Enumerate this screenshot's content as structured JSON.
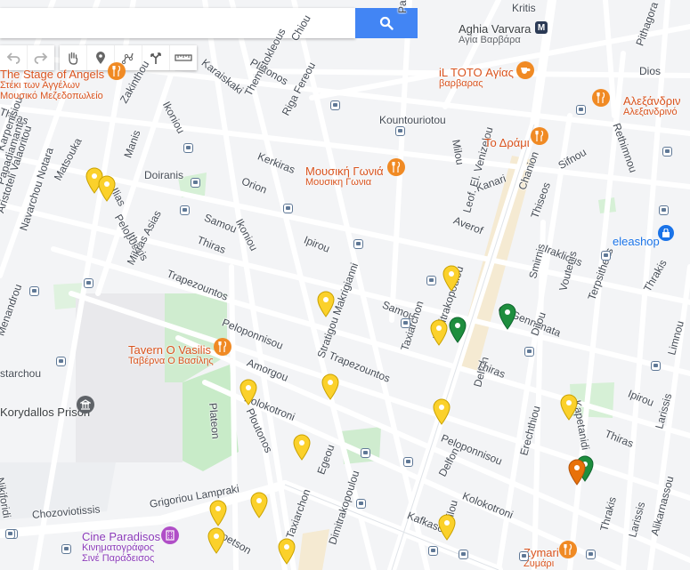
{
  "search": {
    "placeholder": "",
    "button_icon": "search-icon"
  },
  "toolbar": {
    "group1": [
      {
        "icon": "undo-icon"
      },
      {
        "icon": "redo-icon"
      }
    ],
    "group2": [
      {
        "icon": "hand-pan-icon"
      },
      {
        "icon": "add-marker-icon"
      },
      {
        "icon": "draw-line-icon"
      },
      {
        "icon": "add-directions-icon"
      },
      {
        "icon": "measure-ruler-icon"
      }
    ]
  },
  "colors": {
    "accent": "#4285f4",
    "pin_yellow": "#fbd12b",
    "pin_green": "#1e8e3e",
    "pin_orange": "#e8710a",
    "poi_orange": "#f08a24",
    "metro_navy": "#2b3a55"
  },
  "streets": [
    {
      "text": "Kritis",
      "rot": 0
    },
    {
      "text": "Karaiskaki",
      "rot": 38
    },
    {
      "text": "Platonos",
      "rot": 30
    },
    {
      "text": "Chiou",
      "rot": -60
    },
    {
      "text": "Paleon Polemiston",
      "rot": -90
    },
    {
      "text": "Pithagora",
      "rot": -70
    },
    {
      "text": "Dios",
      "rot": 0
    },
    {
      "text": "Thiras",
      "rot": 20
    },
    {
      "text": "Zakinthou",
      "rot": -60
    },
    {
      "text": "Ikoniou",
      "rot": 62
    },
    {
      "text": "Themistokleous",
      "rot": -62
    },
    {
      "text": "Riga Fereou",
      "rot": -62
    },
    {
      "text": "Kountouriotou",
      "rot": 0
    },
    {
      "text": "Milou",
      "rot": 80
    },
    {
      "text": "Rethimnou",
      "rot": 70
    },
    {
      "text": "Sifnou",
      "rot": -30
    },
    {
      "text": "Karpenisiou",
      "rot": -70
    },
    {
      "text": "Papadiamanti",
      "rot": -72
    },
    {
      "text": "Matsouka",
      "rot": -62
    },
    {
      "text": "Manis",
      "rot": -70
    },
    {
      "text": "Doiranis",
      "rot": 0
    },
    {
      "text": "Kerkiras",
      "rot": 22
    },
    {
      "text": "Orion",
      "rot": 22
    },
    {
      "text": "Ilias",
      "rot": 62
    },
    {
      "text": "Aristoteli Valaoritou",
      "rot": -72
    },
    {
      "text": "Navarchou Notara",
      "rot": -72
    },
    {
      "text": "Pelopos",
      "rot": 60
    },
    {
      "text": "Ithakis",
      "rot": 60
    },
    {
      "text": "Samou",
      "rot": 22
    },
    {
      "text": "Ikoniou",
      "rot": 62
    },
    {
      "text": "Kanari",
      "rot": -20
    },
    {
      "text": "Leof. El. Venizelou",
      "rot": -75
    },
    {
      "text": "Chanion",
      "rot": -70
    },
    {
      "text": "Thiseos",
      "rot": -70
    },
    {
      "text": "Averof",
      "rot": 22
    },
    {
      "text": "Ipirou",
      "rot": 22
    },
    {
      "text": "Thiras",
      "rot": 22
    },
    {
      "text": "Mikras Asias",
      "rot": -62
    },
    {
      "text": "Trapezountos",
      "rot": 22
    },
    {
      "text": "Iraklious",
      "rot": 22
    },
    {
      "text": "Smirnis",
      "rot": -75
    },
    {
      "text": "Samou",
      "rot": 22
    },
    {
      "text": "G. Gennimata",
      "rot": 22
    },
    {
      "text": "Voutenis",
      "rot": -75
    },
    {
      "text": "Terpsitheas",
      "rot": -70
    },
    {
      "text": "Thrakis",
      "rot": -60
    },
    {
      "text": "Menandrou",
      "rot": -70
    },
    {
      "text": "Peloponnisou",
      "rot": 22
    },
    {
      "text": "Amorgou",
      "rot": 22
    },
    {
      "text": "Trapezountos",
      "rot": 22
    },
    {
      "text": "Dimitrakopoulou",
      "rot": -72
    },
    {
      "text": "Taxiarchon",
      "rot": -72
    },
    {
      "text": "Delfon",
      "rot": -75
    },
    {
      "text": "Thiras",
      "rot": 22
    },
    {
      "text": "Dilou",
      "rot": -70
    },
    {
      "text": "Ipirou",
      "rot": 22
    },
    {
      "text": "Limnou",
      "rot": -75
    },
    {
      "text": "starchou",
      "rot": 0
    },
    {
      "text": "Kolokotroni",
      "rot": 22
    },
    {
      "text": "Plateon",
      "rot": 85
    },
    {
      "text": "Ploutonos",
      "rot": 65
    },
    {
      "text": "Stratigou Makrigianni",
      "rot": -70
    },
    {
      "text": "Kapetanidi",
      "rot": 80
    },
    {
      "text": "Thiras",
      "rot": 22
    },
    {
      "text": "Peloponnisou",
      "rot": 22
    },
    {
      "text": "Erechthiou",
      "rot": -75
    },
    {
      "text": "Larissis",
      "rot": -75
    },
    {
      "text": "Nikiforidi",
      "rot": 80
    },
    {
      "text": "Chozoviotissis",
      "rot": -5
    },
    {
      "text": "Grigoriou Lampraki",
      "rot": -10
    },
    {
      "text": "Egeou",
      "rot": -70
    },
    {
      "text": "Delfon",
      "rot": -62
    },
    {
      "text": "Kolokotroni",
      "rot": 22
    },
    {
      "text": "Kafkasou",
      "rot": 22
    },
    {
      "text": "Dilou",
      "rot": -75
    },
    {
      "text": "Thrakis",
      "rot": -75
    },
    {
      "text": "Larissis",
      "rot": -75
    },
    {
      "text": "Alikarnassou",
      "rot": -75
    },
    {
      "text": "Taxiarchon",
      "rot": -70
    },
    {
      "text": "Dimitrakopoulou",
      "rot": -72
    },
    {
      "text": "petson",
      "rot": 30
    }
  ],
  "pois": [
    {
      "name": "Aghia Varvara",
      "sub": "Αγία Βαρβάρα",
      "type": "metro"
    },
    {
      "name": "iL TOTO Αγίας",
      "sub": "βαρβαρας",
      "type": "cafe"
    },
    {
      "name": "Αλεξάνδριν",
      "sub": "Αλεξανδρινό",
      "type": "restaurant"
    },
    {
      "name": "The Stage of Angels",
      "sub": "Στέκι των Αγγέλων",
      "sub2": "Μουσικό Μεζεδοπωλείο",
      "type": "restaurant"
    },
    {
      "name": "Το Δράμι",
      "sub": "",
      "type": "restaurant"
    },
    {
      "name": "Μουσική Γωνιά",
      "sub": "Μουσικη Γωνια",
      "type": "restaurant"
    },
    {
      "name": "eleashop",
      "sub": "",
      "type": "shop"
    },
    {
      "name": "Tavern O Vasilis",
      "sub": "Ταβέρνα Ο Βασίλης",
      "type": "restaurant"
    },
    {
      "name": "Korydallos Prison",
      "sub": "",
      "type": "landmark"
    },
    {
      "name": "Cine Paradisos",
      "sub": "Κινηματογράφος",
      "sub2": "Σινέ Παράδεισος",
      "type": "cinema"
    },
    {
      "name": "Zymari",
      "sub": "Ζυμάρι",
      "type": "restaurant"
    }
  ],
  "markers": [
    {
      "color": "yellow"
    },
    {
      "color": "yellow"
    },
    {
      "color": "yellow"
    },
    {
      "color": "yellow"
    },
    {
      "color": "yellow"
    },
    {
      "color": "yellow"
    },
    {
      "color": "yellow"
    },
    {
      "color": "yellow"
    },
    {
      "color": "yellow"
    },
    {
      "color": "yellow"
    },
    {
      "color": "yellow"
    },
    {
      "color": "yellow"
    },
    {
      "color": "yellow"
    },
    {
      "color": "yellow"
    },
    {
      "color": "yellow"
    },
    {
      "color": "green"
    },
    {
      "color": "green"
    },
    {
      "color": "green"
    },
    {
      "color": "orange"
    }
  ]
}
